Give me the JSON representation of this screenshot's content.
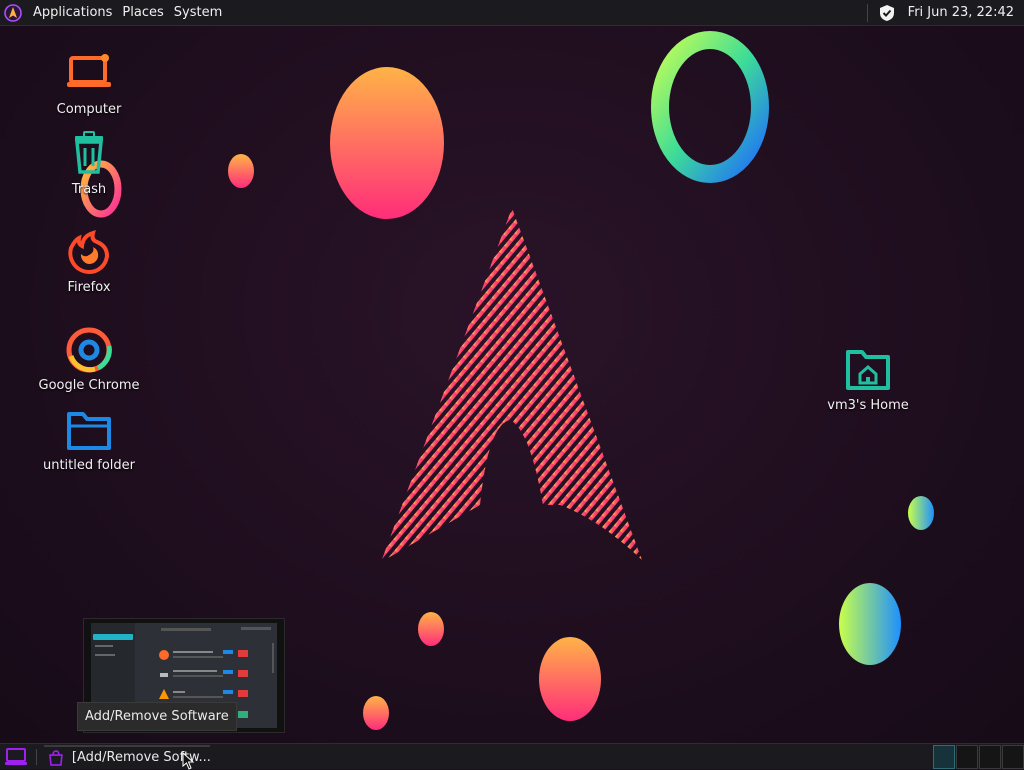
{
  "top_panel": {
    "menus": [
      "Applications",
      "Places",
      "System"
    ],
    "clock": "Fri Jun 23, 22:42"
  },
  "desktop": {
    "icons": [
      {
        "label": "Computer",
        "icon": "computer-icon"
      },
      {
        "label": "Trash",
        "icon": "trash-icon"
      },
      {
        "label": "Firefox",
        "icon": "firefox-icon"
      },
      {
        "label": "Google Chrome",
        "icon": "chrome-icon"
      },
      {
        "label": "untitled folder",
        "icon": "folder-icon"
      },
      {
        "label": "vm3's Home",
        "icon": "home-folder-icon"
      }
    ]
  },
  "window_preview": {
    "tooltip": "Add/Remove Software"
  },
  "taskbar": {
    "task_label": "[Add/Remove Softw...",
    "workspace_count": 4,
    "active_workspace": 1
  },
  "colors": {
    "accent_purple": "#a020f0",
    "panel_bg": "#1b1b1f",
    "icon_orange": "#ff6a2a",
    "icon_teal": "#1fbfa0",
    "icon_blue": "#1e88e5"
  }
}
